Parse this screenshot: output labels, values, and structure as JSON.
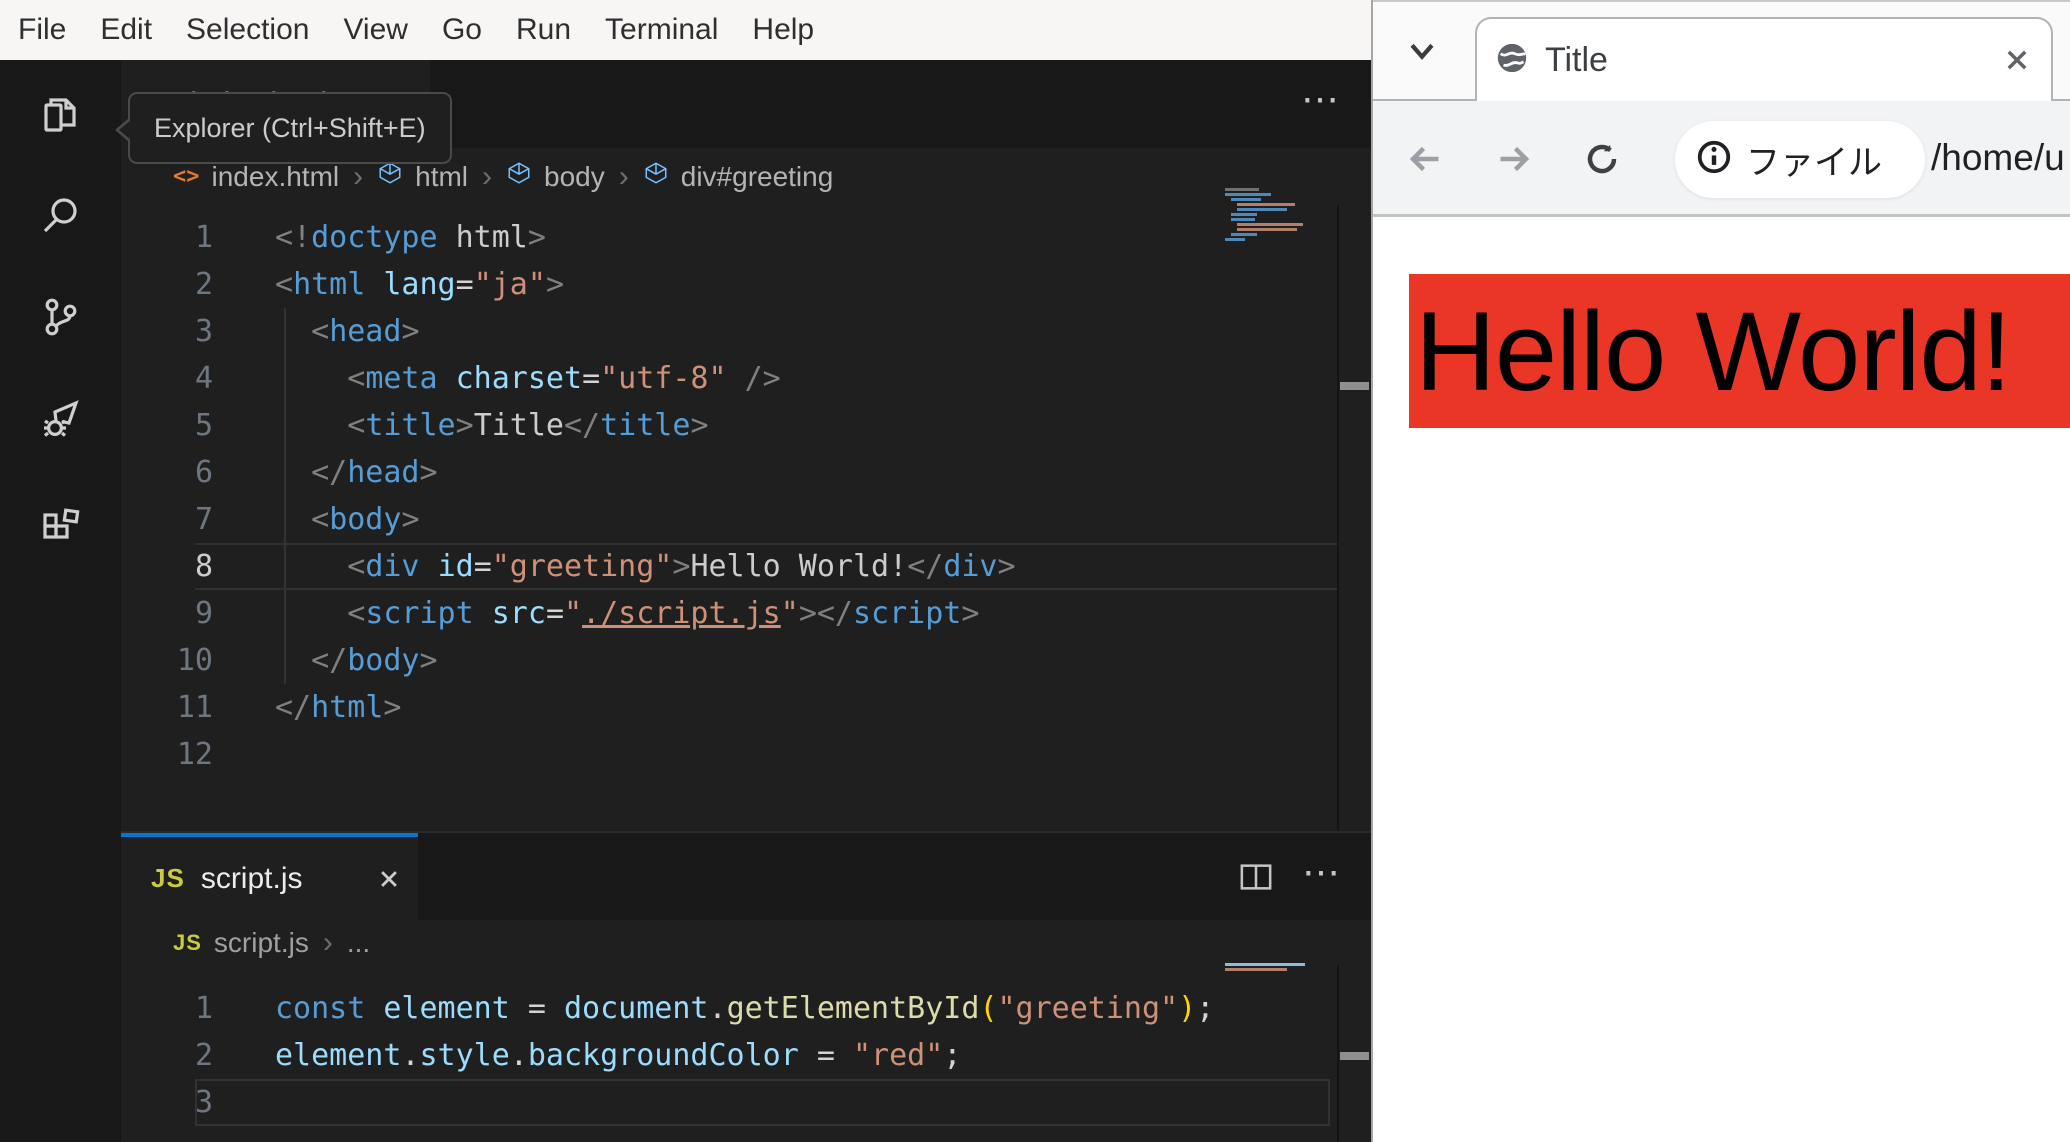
{
  "colors": {
    "accent_blue": "#0078d4",
    "greeting_red": "#ea3627",
    "editor_bg": "#1f1f1f",
    "activitybar_bg": "#181818"
  },
  "vscode": {
    "menu": {
      "items": [
        "File",
        "Edit",
        "Selection",
        "View",
        "Go",
        "Run",
        "Terminal",
        "Help"
      ]
    },
    "activity_bar": {
      "tooltip": "Explorer (Ctrl+Shift+E)",
      "icons": [
        "explorer-icon",
        "search-icon",
        "source-control-icon",
        "run-debug-icon",
        "extensions-icon"
      ]
    },
    "editor1": {
      "tab": {
        "label": "index.html"
      },
      "actions": {
        "more": "⋯"
      },
      "breadcrumb": {
        "file": "index.html",
        "path": [
          "html",
          "body",
          "div#greeting"
        ]
      },
      "current_line": 8,
      "lines": [
        {
          "n": "1",
          "tokens": [
            [
              "punct",
              "<!"
            ],
            [
              "tag",
              "doctype"
            ],
            [
              "fg",
              " html"
            ],
            [
              "punct",
              ">"
            ]
          ]
        },
        {
          "n": "2",
          "tokens": [
            [
              "punct",
              "<"
            ],
            [
              "tag",
              "html"
            ],
            [
              "fg",
              " "
            ],
            [
              "attr",
              "lang"
            ],
            [
              "op",
              "="
            ],
            [
              "str",
              "\"ja\""
            ],
            [
              "punct",
              ">"
            ]
          ]
        },
        {
          "n": "3",
          "tokens": [
            [
              "fg",
              "  "
            ],
            [
              "punct",
              "<"
            ],
            [
              "tag",
              "head"
            ],
            [
              "punct",
              ">"
            ]
          ]
        },
        {
          "n": "4",
          "tokens": [
            [
              "fg",
              "    "
            ],
            [
              "punct",
              "<"
            ],
            [
              "tag",
              "meta"
            ],
            [
              "fg",
              " "
            ],
            [
              "attr",
              "charset"
            ],
            [
              "op",
              "="
            ],
            [
              "str",
              "\"utf-8\""
            ],
            [
              "fg",
              " "
            ],
            [
              "punct",
              "/>"
            ]
          ]
        },
        {
          "n": "5",
          "tokens": [
            [
              "fg",
              "    "
            ],
            [
              "punct",
              "<"
            ],
            [
              "tag",
              "title"
            ],
            [
              "punct",
              ">"
            ],
            [
              "fg",
              "Title"
            ],
            [
              "punct",
              "</"
            ],
            [
              "tag",
              "title"
            ],
            [
              "punct",
              ">"
            ]
          ]
        },
        {
          "n": "6",
          "tokens": [
            [
              "fg",
              "  "
            ],
            [
              "punct",
              "</"
            ],
            [
              "tag",
              "head"
            ],
            [
              "punct",
              ">"
            ]
          ]
        },
        {
          "n": "7",
          "tokens": [
            [
              "fg",
              "  "
            ],
            [
              "punct",
              "<"
            ],
            [
              "tag",
              "body"
            ],
            [
              "punct",
              ">"
            ]
          ]
        },
        {
          "n": "8",
          "tokens": [
            [
              "fg",
              "    "
            ],
            [
              "punct",
              "<"
            ],
            [
              "tag",
              "div"
            ],
            [
              "fg",
              " "
            ],
            [
              "attr",
              "id"
            ],
            [
              "op",
              "="
            ],
            [
              "str",
              "\"greeting\""
            ],
            [
              "punct",
              ">"
            ],
            [
              "fg",
              "Hello World!"
            ],
            [
              "punct",
              "</"
            ],
            [
              "tag",
              "div"
            ],
            [
              "punct",
              ">"
            ]
          ]
        },
        {
          "n": "9",
          "tokens": [
            [
              "fg",
              "    "
            ],
            [
              "punct",
              "<"
            ],
            [
              "tag",
              "script"
            ],
            [
              "fg",
              " "
            ],
            [
              "attr",
              "src"
            ],
            [
              "op",
              "="
            ],
            [
              "str",
              "\""
            ],
            [
              "strlink",
              "./script.js"
            ],
            [
              "str",
              "\""
            ],
            [
              "punct",
              ">"
            ],
            [
              "punct",
              "</"
            ],
            [
              "tag",
              "script"
            ],
            [
              "punct",
              ">"
            ]
          ]
        },
        {
          "n": "10",
          "tokens": [
            [
              "fg",
              "  "
            ],
            [
              "punct",
              "</"
            ],
            [
              "tag",
              "body"
            ],
            [
              "punct",
              ">"
            ]
          ]
        },
        {
          "n": "11",
          "tokens": [
            [
              "punct",
              "</"
            ],
            [
              "tag",
              "html"
            ],
            [
              "punct",
              ">"
            ]
          ]
        },
        {
          "n": "12",
          "tokens": []
        }
      ]
    },
    "editor2": {
      "tab": {
        "label": "script.js"
      },
      "actions": {
        "more": "⋯"
      },
      "breadcrumb": {
        "file": "script.js",
        "tail": "..."
      },
      "current_line": 3,
      "lines": [
        {
          "n": "1",
          "tokens": [
            [
              "kw",
              "const"
            ],
            [
              "var",
              " element"
            ],
            [
              "op",
              " = "
            ],
            [
              "var",
              "document"
            ],
            [
              "op",
              "."
            ],
            [
              "fn",
              "getElementById"
            ],
            [
              "paren",
              "("
            ],
            [
              "str",
              "\"greeting\""
            ],
            [
              "paren",
              ")"
            ],
            [
              "op",
              ";"
            ]
          ]
        },
        {
          "n": "2",
          "tokens": [
            [
              "var",
              "element"
            ],
            [
              "op",
              "."
            ],
            [
              "var",
              "style"
            ],
            [
              "op",
              "."
            ],
            [
              "var",
              "backgroundColor"
            ],
            [
              "op",
              " = "
            ],
            [
              "str",
              "\"red\""
            ],
            [
              "op",
              ";"
            ]
          ]
        },
        {
          "n": "3",
          "tokens": []
        }
      ]
    }
  },
  "browser": {
    "tab": {
      "title": "Title"
    },
    "toolbar": {
      "chip_label": "ファイル",
      "url": "/home/u"
    },
    "page": {
      "greeting": "Hello World!"
    }
  }
}
